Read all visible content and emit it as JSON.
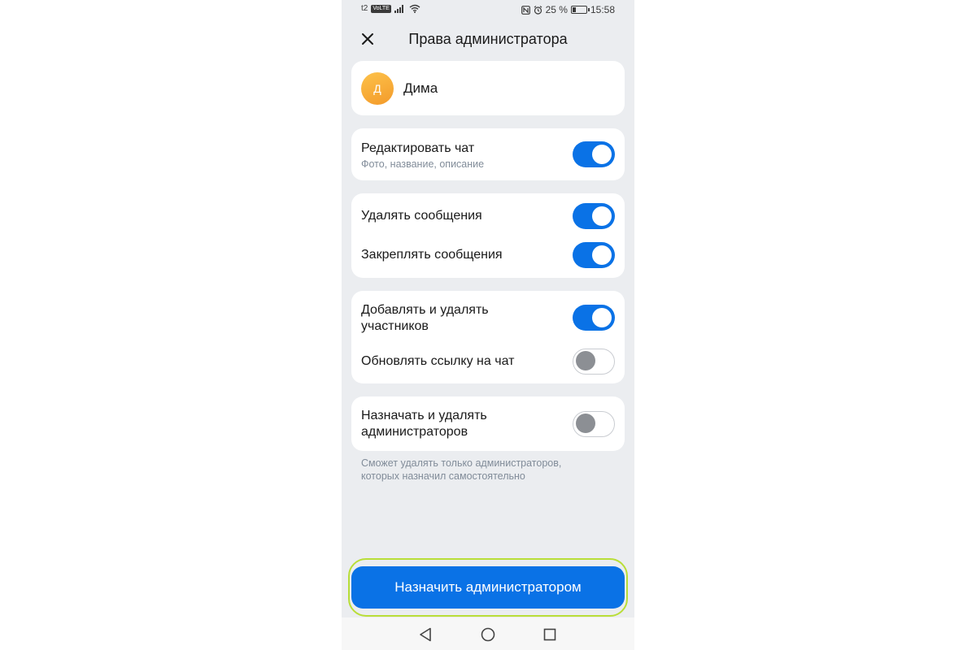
{
  "statusbar": {
    "carrier": "t2",
    "carrier_badge": "VoLTE",
    "battery": "25 %",
    "battery_level": 0.25,
    "time": "15:58"
  },
  "header": {
    "title": "Права администратора"
  },
  "user": {
    "initial": "Д",
    "name": "Дима"
  },
  "groups": [
    {
      "items": [
        {
          "label": "Редактировать чат",
          "subtitle": "Фото, название, описание",
          "enabled": true
        }
      ]
    },
    {
      "items": [
        {
          "label": "Удалять сообщения",
          "enabled": true
        },
        {
          "label": "Закреплять сообщения",
          "enabled": true
        }
      ]
    },
    {
      "items": [
        {
          "label_line1": "Добавлять и удалять",
          "label_line2": "участников",
          "enabled": true
        },
        {
          "label": "Обновлять ссылку на чат",
          "enabled": false
        }
      ]
    },
    {
      "items": [
        {
          "label_line1": "Назначать и удалять",
          "label_line2": "администраторов",
          "enabled": false
        }
      ]
    }
  ],
  "footnote": {
    "line1": "Сможет удалять только администраторов,",
    "line2": "которых назначил самостоятельно"
  },
  "cta": {
    "label": "Назначить администратором"
  },
  "colors": {
    "accent": "#0a72e6",
    "background": "#ebedf0",
    "highlight_ring": "#b9de38",
    "avatar": "#f7a935"
  }
}
